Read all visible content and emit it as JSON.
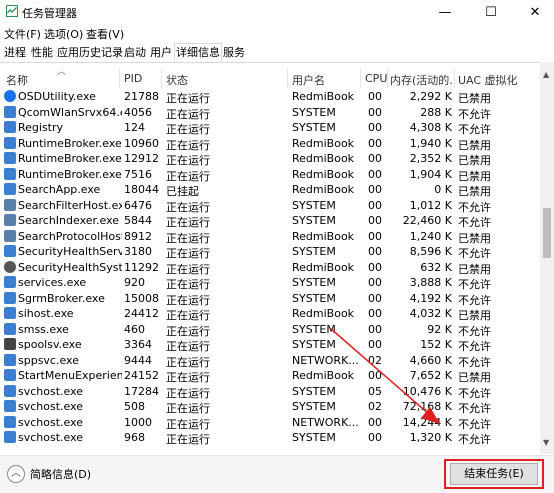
{
  "window": {
    "title": "任务管理器",
    "minimize": "—",
    "maximize": "☐",
    "close": "✕"
  },
  "menu": [
    "文件(F)",
    "选项(O)",
    "查看(V)"
  ],
  "tabs": [
    "进程",
    "性能",
    "应用历史记录",
    "启动",
    "用户",
    "详细信息",
    "服务"
  ],
  "active_tab": "详细信息",
  "columns": {
    "name": "名称",
    "pid": "PID",
    "status": "状态",
    "user": "用户名",
    "cpu": "CPU",
    "mem": "内存(活动的...",
    "uac": "UAC 虚拟化"
  },
  "rows": [
    {
      "name": "OSDUtility.exe",
      "pid": "21788",
      "status": "正在运行",
      "user": "RedmiBook",
      "cpu": "00",
      "mem": "2,292 K",
      "uac": "已禁用",
      "icon": "osd-icon",
      "color": "#1a73e8"
    },
    {
      "name": "QcomWlanSrvx64.e...",
      "pid": "4056",
      "status": "正在运行",
      "user": "SYSTEM",
      "cpu": "00",
      "mem": "288 K",
      "uac": "不允许",
      "icon": "window-icon",
      "color": "#3c7fd0"
    },
    {
      "name": "Registry",
      "pid": "124",
      "status": "正在运行",
      "user": "SYSTEM",
      "cpu": "00",
      "mem": "4,308 K",
      "uac": "不允许",
      "icon": "window-icon",
      "color": "#3c7fd0"
    },
    {
      "name": "RuntimeBroker.exe",
      "pid": "10960",
      "status": "正在运行",
      "user": "RedmiBook",
      "cpu": "00",
      "mem": "1,940 K",
      "uac": "已禁用",
      "icon": "window-icon",
      "color": "#3c7fd0"
    },
    {
      "name": "RuntimeBroker.exe",
      "pid": "12912",
      "status": "正在运行",
      "user": "RedmiBook",
      "cpu": "00",
      "mem": "2,352 K",
      "uac": "已禁用",
      "icon": "window-icon",
      "color": "#3c7fd0"
    },
    {
      "name": "RuntimeBroker.exe",
      "pid": "7516",
      "status": "正在运行",
      "user": "RedmiBook",
      "cpu": "00",
      "mem": "1,904 K",
      "uac": "已禁用",
      "icon": "window-icon",
      "color": "#3c7fd0"
    },
    {
      "name": "SearchApp.exe",
      "pid": "18044",
      "status": "已挂起",
      "user": "RedmiBook",
      "cpu": "00",
      "mem": "0 K",
      "uac": "已禁用",
      "icon": "window-icon",
      "color": "#3c7fd0"
    },
    {
      "name": "SearchFilterHost.exe",
      "pid": "6476",
      "status": "正在运行",
      "user": "SYSTEM",
      "cpu": "00",
      "mem": "1,012 K",
      "uac": "不允许",
      "icon": "search-icon",
      "color": "#5a7fa8"
    },
    {
      "name": "SearchIndexer.exe",
      "pid": "5844",
      "status": "正在运行",
      "user": "SYSTEM",
      "cpu": "00",
      "mem": "22,460 K",
      "uac": "不允许",
      "icon": "search-icon",
      "color": "#5a7fa8"
    },
    {
      "name": "SearchProtocolHost...",
      "pid": "8912",
      "status": "正在运行",
      "user": "RedmiBook",
      "cpu": "00",
      "mem": "1,240 K",
      "uac": "已禁用",
      "icon": "search-icon",
      "color": "#5a7fa8"
    },
    {
      "name": "SecurityHealthServi...",
      "pid": "3180",
      "status": "正在运行",
      "user": "SYSTEM",
      "cpu": "00",
      "mem": "8,596 K",
      "uac": "不允许",
      "icon": "window-icon",
      "color": "#3c7fd0"
    },
    {
      "name": "SecurityHealthSystr...",
      "pid": "11292",
      "status": "正在运行",
      "user": "RedmiBook",
      "cpu": "00",
      "mem": "632 K",
      "uac": "已禁用",
      "icon": "shield-icon",
      "color": "#555555"
    },
    {
      "name": "services.exe",
      "pid": "920",
      "status": "正在运行",
      "user": "SYSTEM",
      "cpu": "00",
      "mem": "3,888 K",
      "uac": "不允许",
      "icon": "window-icon",
      "color": "#3c7fd0"
    },
    {
      "name": "SgrmBroker.exe",
      "pid": "15008",
      "status": "正在运行",
      "user": "SYSTEM",
      "cpu": "00",
      "mem": "4,192 K",
      "uac": "不允许",
      "icon": "window-icon",
      "color": "#3c7fd0"
    },
    {
      "name": "sihost.exe",
      "pid": "24412",
      "status": "正在运行",
      "user": "RedmiBook",
      "cpu": "00",
      "mem": "4,032 K",
      "uac": "已禁用",
      "icon": "window-icon",
      "color": "#3c7fd0"
    },
    {
      "name": "smss.exe",
      "pid": "460",
      "status": "正在运行",
      "user": "SYSTEM",
      "cpu": "00",
      "mem": "92 K",
      "uac": "不允许",
      "icon": "window-icon",
      "color": "#3c7fd0"
    },
    {
      "name": "spoolsv.exe",
      "pid": "3364",
      "status": "正在运行",
      "user": "SYSTEM",
      "cpu": "00",
      "mem": "152 K",
      "uac": "不允许",
      "icon": "printer-icon",
      "color": "#444444"
    },
    {
      "name": "sppsvc.exe",
      "pid": "9444",
      "status": "正在运行",
      "user": "NETWORK...",
      "cpu": "02",
      "mem": "4,660 K",
      "uac": "不允许",
      "icon": "window-icon",
      "color": "#3c7fd0"
    },
    {
      "name": "StartMenuExperien...",
      "pid": "24152",
      "status": "正在运行",
      "user": "RedmiBook",
      "cpu": "00",
      "mem": "7,652 K",
      "uac": "已禁用",
      "icon": "window-icon",
      "color": "#3c7fd0"
    },
    {
      "name": "svchost.exe",
      "pid": "17284",
      "status": "正在运行",
      "user": "SYSTEM",
      "cpu": "05",
      "mem": "10,476 K",
      "uac": "不允许",
      "icon": "window-icon",
      "color": "#3c7fd0"
    },
    {
      "name": "svchost.exe",
      "pid": "508",
      "status": "正在运行",
      "user": "SYSTEM",
      "cpu": "02",
      "mem": "72,168 K",
      "uac": "不允许",
      "icon": "window-icon",
      "color": "#3c7fd0"
    },
    {
      "name": "svchost.exe",
      "pid": "1000",
      "status": "正在运行",
      "user": "NETWORK...",
      "cpu": "00",
      "mem": "14,244 K",
      "uac": "不允许",
      "icon": "window-icon",
      "color": "#3c7fd0"
    },
    {
      "name": "svchost.exe",
      "pid": "968",
      "status": "正在运行",
      "user": "SYSTEM",
      "cpu": "00",
      "mem": "1,320 K",
      "uac": "不允许",
      "icon": "window-icon",
      "color": "#3c7fd0"
    }
  ],
  "footer": {
    "collapse_label": "简略信息(D)",
    "end_task_label": "结束任务(E)"
  },
  "colors": {
    "highlight": "#e02020",
    "app_icon": "#2f8f4e"
  }
}
